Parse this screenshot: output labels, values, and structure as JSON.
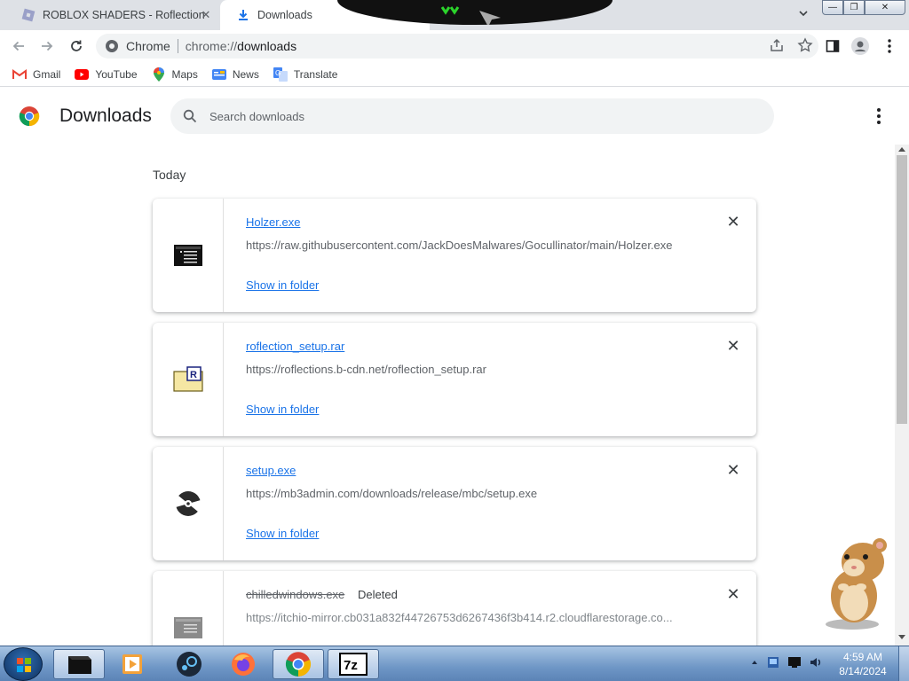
{
  "tabs": [
    {
      "title": "ROBLOX SHADERS - Roflection",
      "close": "✕"
    },
    {
      "title": "Downloads",
      "close": "✕"
    }
  ],
  "window_controls": {
    "minimize": "—",
    "maximize": "❐",
    "close": "✕"
  },
  "omnibox": {
    "site_label": "Chrome",
    "url_prefix": "chrome://",
    "url_path": "downloads"
  },
  "bookmarks": [
    {
      "label": "Gmail",
      "icon": "gmail-icon"
    },
    {
      "label": "YouTube",
      "icon": "youtube-icon"
    },
    {
      "label": "Maps",
      "icon": "maps-icon"
    },
    {
      "label": "News",
      "icon": "news-icon"
    },
    {
      "label": "Translate",
      "icon": "translate-icon"
    }
  ],
  "page": {
    "title": "Downloads",
    "search_placeholder": "Search downloads",
    "section_label": "Today"
  },
  "downloads": [
    {
      "name": "Holzer.exe",
      "url": "https://raw.githubusercontent.com/JackDoesMalwares/Gocullinator/main/Holzer.exe",
      "action": "Show in folder",
      "icon": "exe-file-icon",
      "status": ""
    },
    {
      "name": "roflection_setup.rar",
      "url": "https://roflections.b-cdn.net/roflection_setup.rar",
      "action": "Show in folder",
      "icon": "rar-archive-icon",
      "status": ""
    },
    {
      "name": "setup.exe",
      "url": "https://mb3admin.com/downloads/release/mbc/setup.exe",
      "action": "Show in folder",
      "icon": "disc-setup-icon",
      "status": ""
    },
    {
      "name": "chilledwindows.exe",
      "url": "https://itchio-mirror.cb031a832f44726753d6267436f3b414.r2.cloudflarestorage.co...",
      "action": "",
      "icon": "exe-file-icon",
      "status": "Deleted"
    }
  ],
  "taskbar": {
    "apps": [
      "terminal-app",
      "media-player-app",
      "steam-app",
      "firefox-app",
      "chrome-app",
      "7zip-app"
    ],
    "zip_label": "7z",
    "clock_time": "4:59 AM",
    "clock_date": "8/14/2024"
  },
  "colors": {
    "link": "#1a73e8",
    "tab_strip": "#dee1e6",
    "taskbar": "#6f97c6"
  }
}
